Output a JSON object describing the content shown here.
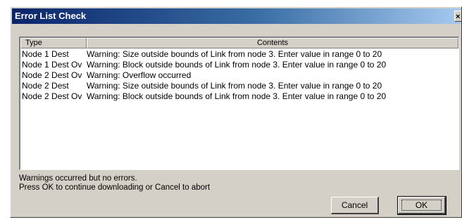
{
  "window": {
    "title": "Error List Check",
    "close_glyph": "×"
  },
  "list": {
    "columns": [
      "Type",
      "Contents"
    ],
    "rows": [
      {
        "type": "Node 1 Dest",
        "contents": "Warning: Size outside bounds of Link from node 3. Enter value in  range 0 to 20"
      },
      {
        "type": "Node 1 Dest Ov",
        "contents": "Warning: Block outside bounds of Link from node 3. Enter value in  range 0 to 20"
      },
      {
        "type": "Node 2 Dest Ov",
        "contents": "Warning: Overflow occurred"
      },
      {
        "type": "Node 2 Dest",
        "contents": "Warning: Size outside bounds of Link from node 3. Enter value in  range 0 to 20"
      },
      {
        "type": "Node 2 Dest Ov",
        "contents": "Warning: Block outside bounds of Link from node 3. Enter value in  range 0 to 20"
      }
    ]
  },
  "status": {
    "line1": "Warnings occurred but no errors.",
    "line2": "Press OK to continue downloading or Cancel to abort"
  },
  "buttons": {
    "cancel": "Cancel",
    "ok": "OK"
  }
}
